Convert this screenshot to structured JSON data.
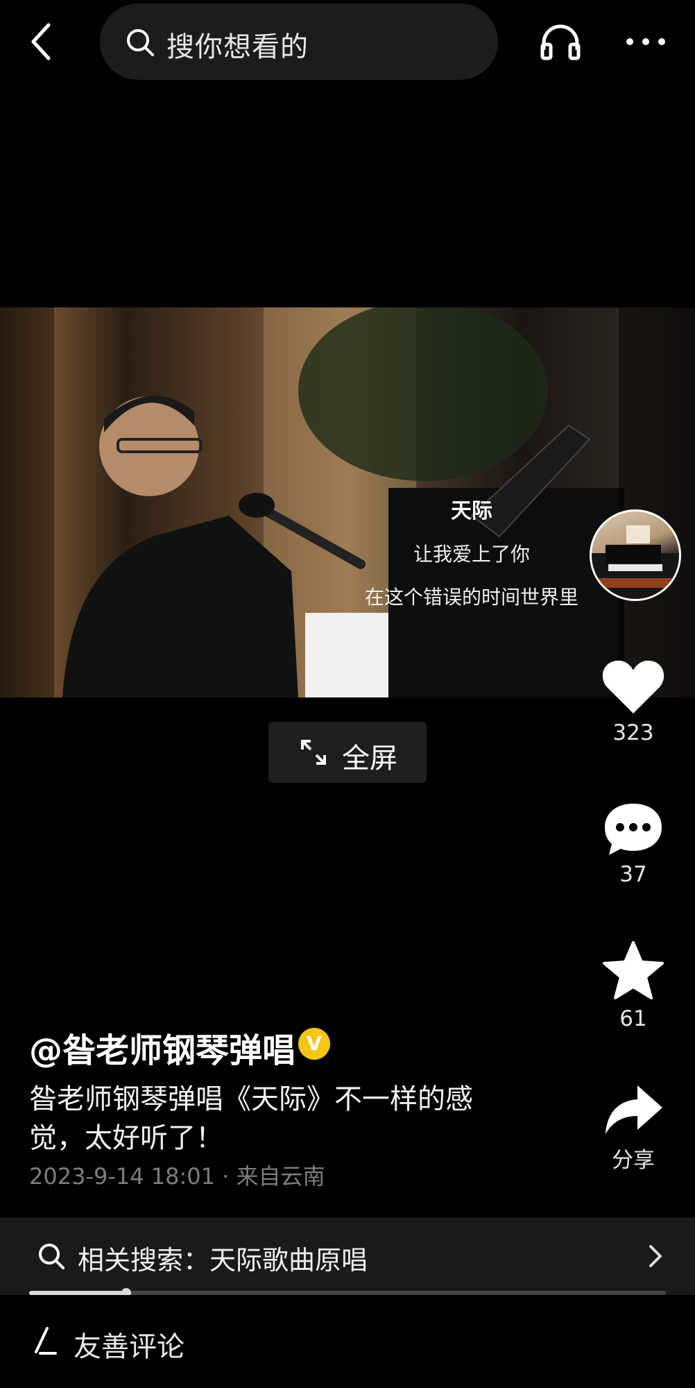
{
  "search": {
    "placeholder": "搜你想看的"
  },
  "video": {
    "lyrics": {
      "title": "天际",
      "lines": [
        "让我爱上了你",
        "在这个错误的时间世界里"
      ]
    },
    "fullscreen_label": "全屏"
  },
  "actions": {
    "like_count": "323",
    "comment_count": "37",
    "favorite_count": "61",
    "share_label": "分享"
  },
  "author": {
    "name": "@昝老师钢琴弹唱",
    "verified_badge": "V"
  },
  "post": {
    "description": "昝老师钢琴弹唱《天际》不一样的感觉，太好听了！",
    "meta": "2023-9-14 18:01 · 来自云南"
  },
  "related_search": {
    "label": "相关搜索：天际歌曲原唱"
  },
  "playback": {
    "progress_fraction": 0.152
  },
  "comment": {
    "placeholder": "友善评论"
  }
}
